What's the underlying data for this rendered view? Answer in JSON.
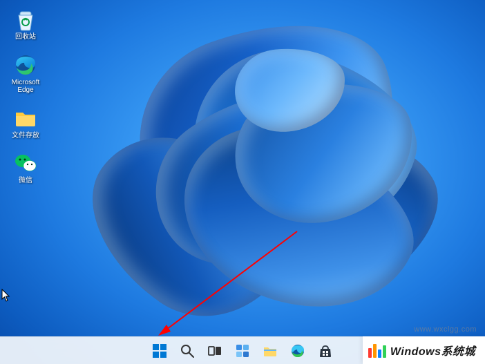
{
  "desktop": {
    "icons": [
      {
        "name": "recycle-bin",
        "label": "回收站"
      },
      {
        "name": "microsoft-edge",
        "label": "Microsoft Edge"
      },
      {
        "name": "file-storage",
        "label": "文件存放"
      },
      {
        "name": "wechat",
        "label": "微信"
      }
    ]
  },
  "taskbar": {
    "items": [
      {
        "name": "start",
        "icon": "windows-logo-icon"
      },
      {
        "name": "search",
        "icon": "search-icon"
      },
      {
        "name": "task-view",
        "icon": "task-view-icon"
      },
      {
        "name": "widgets",
        "icon": "widgets-icon"
      },
      {
        "name": "file-explorer",
        "icon": "file-explorer-icon"
      },
      {
        "name": "edge",
        "icon": "edge-icon"
      },
      {
        "name": "store",
        "icon": "store-icon"
      }
    ]
  },
  "watermark": {
    "text": "Windows系统城",
    "sub": "www.wxclgg.com"
  }
}
